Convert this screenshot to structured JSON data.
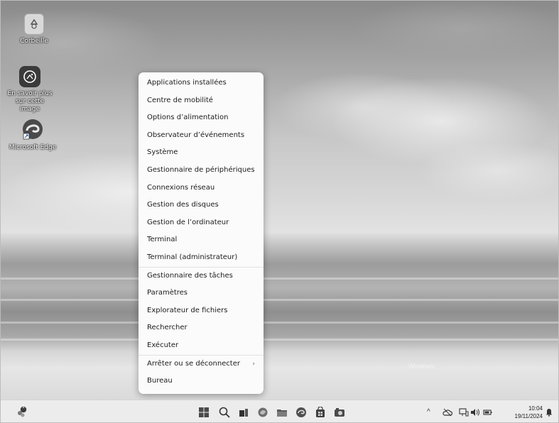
{
  "desktop": {
    "icons": [
      {
        "label": "Corbeille",
        "icon": "recycle-bin-icon"
      },
      {
        "label": "En savoir plus sur cette image",
        "icon": "learn-about-picture-icon"
      },
      {
        "label": "Microsoft Edge",
        "icon": "edge-icon"
      }
    ],
    "watermark": "Windows"
  },
  "context_menu": {
    "items": [
      {
        "label": "Applications installées"
      },
      {
        "label": "Centre de mobilité"
      },
      {
        "label": "Options d’alimentation"
      },
      {
        "label": "Observateur d’événements"
      },
      {
        "label": "Système"
      },
      {
        "label": "Gestionnaire de périphériques"
      },
      {
        "label": "Connexions réseau"
      },
      {
        "label": "Gestion des disques"
      },
      {
        "label": "Gestion de l’ordinateur"
      },
      {
        "label": "Terminal"
      },
      {
        "label": "Terminal (administrateur)"
      },
      {
        "label": "Gestionnaire des tâches"
      },
      {
        "label": "Paramètres"
      },
      {
        "label": "Explorateur de fichiers"
      },
      {
        "label": "Rechercher"
      },
      {
        "label": "Exécuter"
      },
      {
        "label": "Arrêter ou se déconnecter",
        "submenu_arrow": "›"
      },
      {
        "label": "Bureau"
      }
    ]
  },
  "taskbar": {
    "left_widget": "widgets-icon",
    "badge": "1",
    "pinned": [
      "start-icon",
      "search-icon",
      "task-view-icon",
      "copilot-icon",
      "file-explorer-icon",
      "edge-icon",
      "store-icon",
      "camera-icon"
    ],
    "tray": {
      "chevron": "^",
      "time": "10:04",
      "date": "19/11/2024"
    }
  },
  "colors": {
    "menu_bg": "#fbfbfb",
    "taskbar_bg": "#ececec"
  }
}
